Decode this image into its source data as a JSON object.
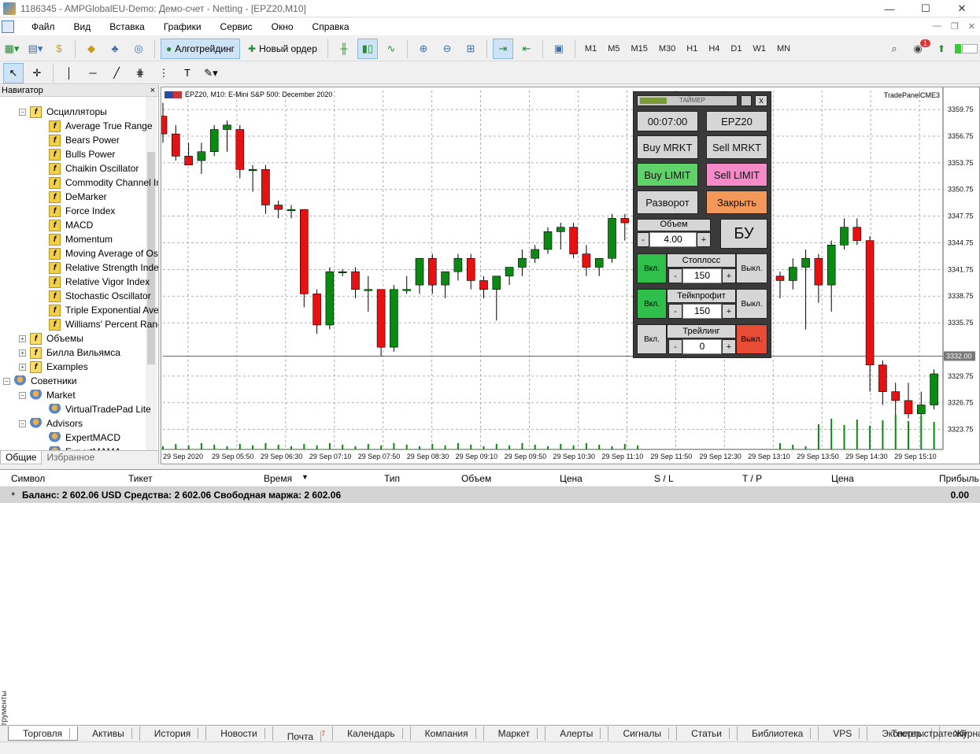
{
  "title": "1186345 - AMPGlobalEU-Demo: Демо-счет - Netting - [EPZ20,M10]",
  "menu": [
    "Файл",
    "Вид",
    "Вставка",
    "Графики",
    "Сервис",
    "Окно",
    "Справка"
  ],
  "toolbar": {
    "algo": "Алготрейдинг",
    "new_order": "Новый ордер",
    "timeframes": [
      "M1",
      "M5",
      "M15",
      "M30",
      "H1",
      "H4",
      "D1",
      "W1",
      "MN"
    ],
    "notif_count": "1"
  },
  "navigator": {
    "title": "Навигатор",
    "items": [
      {
        "label": "Осцилляторы",
        "indent": 1,
        "type": "folder",
        "exp": "−"
      },
      {
        "label": "Average True Range",
        "indent": 2,
        "type": "f"
      },
      {
        "label": "Bears Power",
        "indent": 2,
        "type": "f"
      },
      {
        "label": "Bulls Power",
        "indent": 2,
        "type": "f"
      },
      {
        "label": "Chaikin Oscillator",
        "indent": 2,
        "type": "f"
      },
      {
        "label": "Commodity Channel Index",
        "indent": 2,
        "type": "f"
      },
      {
        "label": "DeMarker",
        "indent": 2,
        "type": "f"
      },
      {
        "label": "Force Index",
        "indent": 2,
        "type": "f"
      },
      {
        "label": "MACD",
        "indent": 2,
        "type": "f"
      },
      {
        "label": "Momentum",
        "indent": 2,
        "type": "f"
      },
      {
        "label": "Moving Average of Oscillator",
        "indent": 2,
        "type": "f"
      },
      {
        "label": "Relative Strength Index",
        "indent": 2,
        "type": "f"
      },
      {
        "label": "Relative Vigor Index",
        "indent": 2,
        "type": "f"
      },
      {
        "label": "Stochastic Oscillator",
        "indent": 2,
        "type": "f"
      },
      {
        "label": "Triple Exponential Average",
        "indent": 2,
        "type": "f"
      },
      {
        "label": "Williams' Percent Range",
        "indent": 2,
        "type": "f"
      },
      {
        "label": "Объемы",
        "indent": 1,
        "type": "folder",
        "exp": "+"
      },
      {
        "label": "Билла Вильямса",
        "indent": 1,
        "type": "folder",
        "exp": "+"
      },
      {
        "label": "Examples",
        "indent": 1,
        "type": "folder",
        "exp": "+"
      },
      {
        "label": "Советники",
        "indent": 0,
        "type": "robot",
        "exp": "−"
      },
      {
        "label": "Market",
        "indent": 1,
        "type": "robot",
        "exp": "−"
      },
      {
        "label": "VirtualTradePad  Lite",
        "indent": 2,
        "type": "robot"
      },
      {
        "label": "Advisors",
        "indent": 1,
        "type": "robot",
        "exp": "−"
      },
      {
        "label": "ExpertMACD",
        "indent": 2,
        "type": "robot"
      },
      {
        "label": "ExpertMAMA",
        "indent": 2,
        "type": "robot"
      }
    ],
    "tabs": [
      "Общие",
      "Избранное"
    ]
  },
  "chart": {
    "symbol_desc": "EPZ20, M10:  E-Mini S&P 500: December 2020",
    "indicator": "TradePanelCME3",
    "price_label": "3332.00"
  },
  "panel": {
    "timer_title": "ТАЙМЕР",
    "timer": "00:07:00",
    "symbol": "EPZ20",
    "buy_mrkt": "Buy MRKT",
    "sell_mrkt": "Sell MRKT",
    "buy_limit": "Buy LIMIT",
    "sell_limit": "Sell LIMIT",
    "reverse": "Разворот",
    "close": "Закрыть",
    "volume_label": "Объем",
    "volume": "4.00",
    "be": "БУ",
    "stoploss_label": "Стоплосс",
    "stoploss": "150",
    "takeprofit_label": "Тейкпрофит",
    "takeprofit": "150",
    "trailing_label": "Трейлинг",
    "trailing": "0",
    "on": "Вкл.",
    "off": "Выкл.",
    "minus": "-",
    "plus": "+",
    "close_x": "x"
  },
  "table": {
    "headers": [
      "Символ",
      "Тикет",
      "Время",
      "Тип",
      "Объем",
      "Цена",
      "S / L",
      "T / P",
      "Цена",
      "Прибыль"
    ],
    "balance": "Баланс: 2 602.06 USD  Средства: 2 602.06  Свободная маржа: 2 602.06",
    "profit": "0.00"
  },
  "side_label": "Инструменты",
  "bottom_tabs": [
    "Торговля",
    "Активы",
    "История",
    "Новости",
    "Почта",
    "Календарь",
    "Компания",
    "Маркет",
    "Алерты",
    "Сигналы",
    "Статьи",
    "Библиотека",
    "VPS",
    "Эксперты",
    "Журнал"
  ],
  "mail_badge": "7",
  "tester": "Тестер стратегий",
  "chart_data": {
    "type": "candlestick",
    "y_ticks": [
      "3359.75",
      "3356.75",
      "3353.75",
      "3350.75",
      "3347.75",
      "3344.75",
      "3341.75",
      "3338.75",
      "3335.75",
      "3332.00",
      "3329.75",
      "3326.75",
      "3323.75"
    ],
    "x_ticks": [
      "29 Sep 2020",
      "29 Sep 05:50",
      "29 Sep 06:30",
      "29 Sep 07:10",
      "29 Sep 07:50",
      "29 Sep 08:30",
      "29 Sep 09:10",
      "29 Sep 09:50",
      "29 Sep 10:30",
      "29 Sep 11:10",
      "29 Sep 11:50",
      "29 Sep 12:30",
      "29 Sep 13:10",
      "29 Sep 13:50",
      "29 Sep 14:30",
      "29 Sep 15:10"
    ],
    "ylim": [
      3321.5,
      3361.0
    ],
    "candles": [
      [
        3359,
        3360.5,
        3356,
        3357
      ],
      [
        3357,
        3358,
        3354,
        3354.5
      ],
      [
        3354.5,
        3356,
        3353.5,
        3353.5
      ],
      [
        3354,
        3356,
        3352.5,
        3355
      ],
      [
        3355,
        3358,
        3354.5,
        3357.5
      ],
      [
        3357.5,
        3358.5,
        3355,
        3358
      ],
      [
        3357.5,
        3358,
        3352,
        3353
      ],
      [
        3353,
        3353.5,
        3350.5,
        3353
      ],
      [
        3353,
        3353.5,
        3348,
        3349
      ],
      [
        3349,
        3349.5,
        3347.5,
        3348.5
      ],
      [
        3348.5,
        3349,
        3347.5,
        3348.5
      ],
      [
        3348.5,
        3348.5,
        3337.5,
        3339
      ],
      [
        3339,
        3339.5,
        3334.5,
        3335.5
      ],
      [
        3335.5,
        3342,
        3335,
        3341.5
      ],
      [
        3341.5,
        3341.8,
        3341,
        3341.5
      ],
      [
        3341.5,
        3342,
        3338.5,
        3339.5
      ],
      [
        3339.5,
        3341,
        3337,
        3339.5
      ],
      [
        3339.5,
        3339.5,
        3332,
        3333
      ],
      [
        3333,
        3340,
        3332.5,
        3339.5
      ],
      [
        3339.5,
        3341,
        3339,
        3339.5
      ],
      [
        3340,
        3342.5,
        3339,
        3343
      ],
      [
        3343,
        3343.5,
        3339,
        3340
      ],
      [
        3340,
        3341,
        3338.5,
        3341.5
      ],
      [
        3341.5,
        3343.5,
        3340.5,
        3343
      ],
      [
        3343,
        3343.5,
        3339.5,
        3340.5
      ],
      [
        3340.5,
        3341,
        3338.5,
        3339.5
      ],
      [
        3339.5,
        3341,
        3336,
        3341
      ],
      [
        3341,
        3342,
        3340,
        3342
      ],
      [
        3342,
        3344,
        3341,
        3343
      ],
      [
        3343,
        3344.5,
        3342.5,
        3344
      ],
      [
        3344,
        3346.5,
        3343.5,
        3346
      ],
      [
        3346,
        3347,
        3344,
        3346.5
      ],
      [
        3346.5,
        3347,
        3343,
        3343.5
      ],
      [
        3343.5,
        3344.5,
        3341,
        3342
      ],
      [
        3342,
        3343,
        3341,
        3343
      ],
      [
        3343,
        3348,
        3342.5,
        3347.5
      ],
      [
        3347.5,
        3348,
        3345,
        3347
      ],
      [
        3347,
        3347.5,
        3343.5,
        3344
      ],
      [
        3341,
        3341.5,
        3338.5,
        3340.5
      ],
      [
        3340.5,
        3343,
        3339.5,
        3342
      ],
      [
        3342,
        3344,
        3335,
        3343
      ],
      [
        3343,
        3343.5,
        3338,
        3340
      ],
      [
        3340,
        3345,
        3337,
        3344.5
      ],
      [
        3344.5,
        3347.5,
        3344,
        3346.5
      ],
      [
        3346.5,
        3347.5,
        3344.5,
        3345
      ],
      [
        3345,
        3345.5,
        3328,
        3331
      ],
      [
        3331,
        3331.5,
        3326.5,
        3328
      ],
      [
        3328,
        3329,
        3324,
        3327
      ],
      [
        3327,
        3329,
        3325,
        3325.5
      ],
      [
        3325.5,
        3328,
        3325,
        3326.5
      ],
      [
        3326.5,
        3330.5,
        3326,
        3330
      ]
    ],
    "volume_marks": "green bars along bottom of chart"
  }
}
